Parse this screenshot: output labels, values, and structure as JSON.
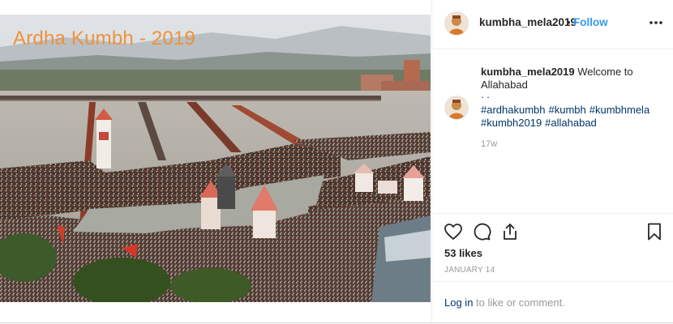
{
  "photo": {
    "overlay_text": "Ardha Kumbh - 2019",
    "overlay_color": "#f0913a"
  },
  "header": {
    "username": "kumbha_mela2019",
    "separator": "•",
    "follow_label": "Follow",
    "more_icon": "more-options-icon"
  },
  "caption": {
    "username": "kumbha_mela2019",
    "text": "Welcome to Allahabad",
    "dots": ". .",
    "hashtags": [
      "#ardhakumbh",
      "#kumbh",
      "#kumbhmela",
      "#kumbh2019",
      "#allahabad"
    ],
    "time_ago": "17w"
  },
  "actions": {
    "icons": [
      "heart-icon",
      "comment-icon",
      "share-icon",
      "bookmark-icon"
    ]
  },
  "likes": "53 likes",
  "date": "JANUARY 14",
  "comment_bar": {
    "login_label": "Log in",
    "rest": " to like or comment."
  },
  "colors": {
    "link": "#3897f0",
    "hashtag": "#003569",
    "muted": "#999999",
    "text": "#262626"
  }
}
